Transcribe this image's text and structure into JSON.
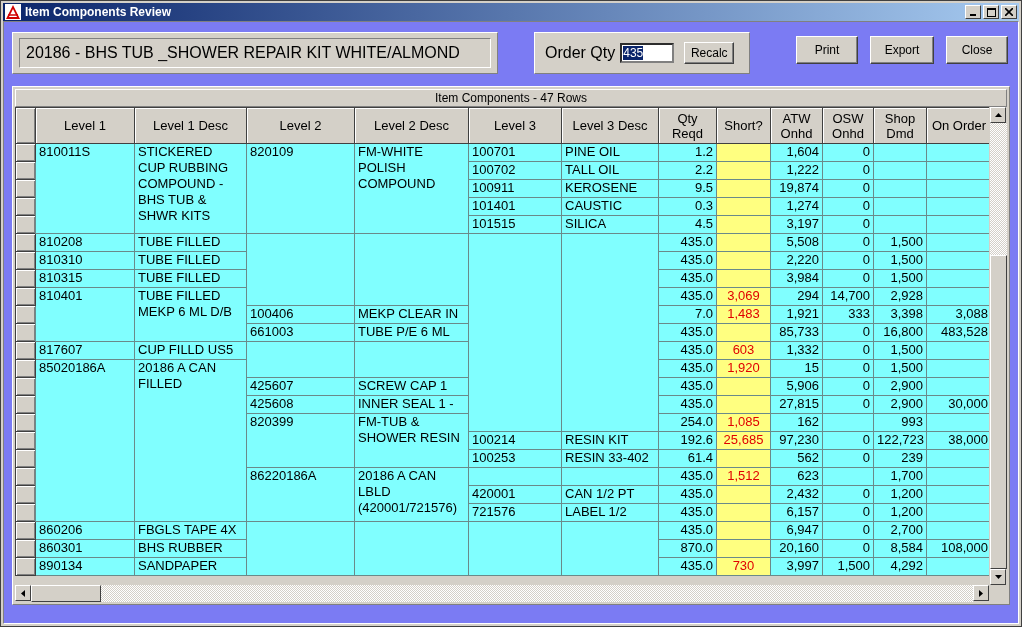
{
  "window": {
    "title": "Item Components Review"
  },
  "item_title": "20186 - BHS TUB _SHOWER REPAIR KIT WHITE/ALMOND",
  "order_qty": {
    "label": "Order Qty",
    "value": "435",
    "text_selected": true,
    "button": "Recalc"
  },
  "buttons": [
    "Print",
    "Export",
    "Close"
  ],
  "table": {
    "caption": "Item Components  -  47 Rows",
    "columns": [
      "Level 1",
      "Level 1 Desc",
      "Level 2",
      "Level 2 Desc",
      "Level 3",
      "Level 3 Desc",
      "Qty\nReqd",
      "Short?",
      "ATW\nOnhd",
      "OSW\nOnhd",
      "Shop\nDmd",
      "On Order"
    ],
    "items": [
      {
        "level_1": "810011S",
        "level_1_desc": "STICKERED CUP RUBBING COMPOUND - BHS TUB & SHWR KITS",
        "components": [
          {
            "level_2": "820109",
            "level_2_desc": "FM-WHITE POLISH COMPOUND",
            "components": [
              {
                "level_3": "100701",
                "level_3_desc": "PINE OIL",
                "qty_reqd": "1.2",
                "atw_onhd": "1,604",
                "osw_onhd": "0"
              },
              {
                "level_3": "100702",
                "level_3_desc": "TALL OIL",
                "qty_reqd": "2.2",
                "atw_onhd": "1,222",
                "osw_onhd": "0"
              },
              {
                "level_3": "100911",
                "level_3_desc": "KEROSENE",
                "qty_reqd": "9.5",
                "atw_onhd": "19,874",
                "osw_onhd": "0"
              },
              {
                "level_3": "101401",
                "level_3_desc": "CAUSTIC",
                "qty_reqd": "0.3",
                "atw_onhd": "1,274",
                "osw_onhd": "0"
              },
              {
                "level_3": "101515",
                "level_3_desc": "SILICA",
                "qty_reqd": "4.5",
                "atw_onhd": "3,197",
                "osw_onhd": "0"
              }
            ]
          }
        ]
      },
      {
        "level_1": "810208",
        "level_1_desc": "TUBE FILLED",
        "components": [
          {
            "components": [
              {
                "qty_reqd": "435.0",
                "atw_onhd": "5,508",
                "osw_onhd": "0",
                "shop_dmd": "1,500"
              }
            ]
          }
        ]
      },
      {
        "level_1": "810310",
        "level_1_desc": "TUBE FILLED",
        "components": [
          {
            "components": [
              {
                "qty_reqd": "435.0",
                "atw_onhd": "2,220",
                "osw_onhd": "0",
                "shop_dmd": "1,500"
              }
            ]
          }
        ]
      },
      {
        "level_1": "810315",
        "level_1_desc": "TUBE FILLED",
        "components": [
          {
            "components": [
              {
                "qty_reqd": "435.0",
                "atw_onhd": "3,984",
                "osw_onhd": "0",
                "shop_dmd": "1,500"
              }
            ]
          }
        ]
      },
      {
        "level_1": "810401",
        "level_1_desc": "TUBE FILLED MEKP  6 ML D/B",
        "components": [
          {
            "components": [
              {
                "qty_reqd": "435.0",
                "short": "3,069",
                "atw_onhd": "294",
                "osw_onhd": "14,700",
                "shop_dmd": "2,928"
              }
            ]
          },
          {
            "level_2": "100406",
            "level_2_desc": "MEKP  CLEAR IN",
            "components": [
              {
                "qty_reqd": "7.0",
                "short": "1,483",
                "atw_onhd": "1,921",
                "osw_onhd": "333",
                "shop_dmd": "3,398",
                "on_order": "3,088"
              }
            ]
          },
          {
            "level_2": "661003",
            "level_2_desc": "TUBE P/E 6 ML",
            "components": [
              {
                "qty_reqd": "435.0",
                "atw_onhd": "85,733",
                "osw_onhd": "0",
                "shop_dmd": "16,800",
                "on_order": "483,528"
              }
            ]
          }
        ]
      },
      {
        "level_1": "817607",
        "level_1_desc": "CUP FILLD US5",
        "components": [
          {
            "components": [
              {
                "qty_reqd": "435.0",
                "short": "603",
                "atw_onhd": "1,332",
                "osw_onhd": "0",
                "shop_dmd": "1,500"
              }
            ]
          }
        ]
      },
      {
        "level_1": "85020186A",
        "level_1_desc": "20186 A CAN FILLED",
        "components": [
          {
            "components": [
              {
                "qty_reqd": "435.0",
                "short": "1,920",
                "atw_onhd": "15",
                "osw_onhd": "0",
                "shop_dmd": "1,500"
              }
            ]
          },
          {
            "level_2": "425607",
            "level_2_desc": "SCREW CAP 1",
            "components": [
              {
                "qty_reqd": "435.0",
                "atw_onhd": "5,906",
                "osw_onhd": "0",
                "shop_dmd": "2,900"
              }
            ]
          },
          {
            "level_2": "425608",
            "level_2_desc": "INNER SEAL 1  -",
            "components": [
              {
                "qty_reqd": "435.0",
                "atw_onhd": "27,815",
                "osw_onhd": "0",
                "shop_dmd": "2,900",
                "on_order": "30,000"
              }
            ]
          },
          {
            "level_2": "820399",
            "level_2_desc": "FM-TUB & SHOWER RESIN",
            "components": [
              {
                "qty_reqd": "254.0",
                "short": "1,085",
                "atw_onhd": "162",
                "shop_dmd": "993"
              },
              {
                "level_3": "100214",
                "level_3_desc": "RESIN KIT",
                "qty_reqd": "192.6",
                "short": "25,685",
                "atw_onhd": "97,230",
                "osw_onhd": "0",
                "shop_dmd": "122,723",
                "on_order": "38,000"
              },
              {
                "level_3": "100253",
                "level_3_desc": "RESIN 33-402",
                "qty_reqd": "61.4",
                "atw_onhd": "562",
                "osw_onhd": "0",
                "shop_dmd": "239"
              }
            ]
          },
          {
            "level_2": "86220186A",
            "level_2_desc": "20186 A CAN LBLD (420001/721576)",
            "components": [
              {
                "qty_reqd": "435.0",
                "short": "1,512",
                "atw_onhd": "623",
                "shop_dmd": "1,700"
              },
              {
                "level_3": "420001",
                "level_3_desc": "CAN 1/2 PT",
                "qty_reqd": "435.0",
                "atw_onhd": "2,432",
                "osw_onhd": "0",
                "shop_dmd": "1,200"
              },
              {
                "level_3": "721576",
                "level_3_desc": "LABEL 1/2",
                "qty_reqd": "435.0",
                "atw_onhd": "6,157",
                "osw_onhd": "0",
                "shop_dmd": "1,200"
              }
            ]
          }
        ]
      },
      {
        "level_1": "860206",
        "level_1_desc": "FBGLS TAPE 4X",
        "components": [
          {
            "components": [
              {
                "qty_reqd": "435.0",
                "atw_onhd": "6,947",
                "osw_onhd": "0",
                "shop_dmd": "2,700"
              }
            ]
          }
        ]
      },
      {
        "level_1": "860301",
        "level_1_desc": "BHS RUBBER",
        "components": [
          {
            "components": [
              {
                "qty_reqd": "870.0",
                "atw_onhd": "20,160",
                "osw_onhd": "0",
                "shop_dmd": "8,584",
                "on_order": "108,000"
              }
            ]
          }
        ]
      },
      {
        "level_1": "890134",
        "level_1_desc": "SANDPAPER",
        "components": [
          {
            "components": [
              {
                "qty_reqd": "435.0",
                "short": "730",
                "atw_onhd": "3,997",
                "osw_onhd": "1,500",
                "shop_dmd": "4,292"
              }
            ]
          }
        ]
      }
    ]
  }
}
